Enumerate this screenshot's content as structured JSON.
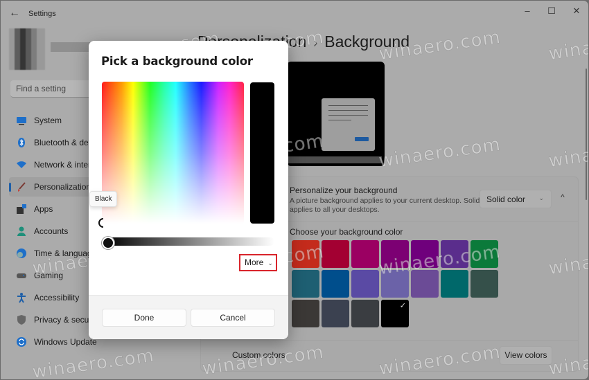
{
  "window": {
    "app_title": "Settings",
    "controls": {
      "minimize": "–",
      "maximize": "☐",
      "close": "✕"
    }
  },
  "sidebar": {
    "search_placeholder": "Find a setting",
    "items": [
      {
        "label": "System",
        "icon": "monitor-icon",
        "color": "#1e6fc9"
      },
      {
        "label": "Bluetooth & devices",
        "icon": "bluetooth-icon",
        "color": "#1e6fc9"
      },
      {
        "label": "Network & internet",
        "icon": "wifi-icon",
        "color": "#1e6fc9"
      },
      {
        "label": "Personalization",
        "icon": "brush-icon",
        "color": "#c4433a",
        "active": true
      },
      {
        "label": "Apps",
        "icon": "apps-icon",
        "color": "#333333"
      },
      {
        "label": "Accounts",
        "icon": "person-icon",
        "color": "#1e8f7a"
      },
      {
        "label": "Time & language",
        "icon": "clock-globe-icon",
        "color": "#1e6fc9"
      },
      {
        "label": "Gaming",
        "icon": "gamepad-icon",
        "color": "#555555"
      },
      {
        "label": "Accessibility",
        "icon": "accessibility-icon",
        "color": "#1e5fa8"
      },
      {
        "label": "Privacy & security",
        "icon": "shield-icon",
        "color": "#666666"
      },
      {
        "label": "Windows Update",
        "icon": "update-icon",
        "color": "#1e6fc9"
      }
    ]
  },
  "main": {
    "breadcrumb_parent": "Personalization",
    "breadcrumb_separator": "›",
    "breadcrumb_current": "Background",
    "personalize_card": {
      "title": "Personalize your background",
      "desc_line1": "A picture background applies to your current desktop. Solid color or slideshow",
      "desc_line2": "applies to all your desktops.",
      "dropdown_value": "Solid color",
      "collapse_icon": "^"
    },
    "color_card": {
      "title": "Choose your background color",
      "swatches": [
        [
          "#c42b1c",
          "#a30032",
          "#9b0062",
          "#7c0073",
          "#6f007c",
          "#5a2d8c",
          "#0b7a3a"
        ],
        [
          "#1e5f72",
          "#004e8c",
          "#5a4aa4",
          "#6b62a8",
          "#6b4b96",
          "#00686a",
          "#35504a"
        ],
        [
          "#3b3836",
          "#3b4150",
          "#3a3d41",
          "#000000"
        ]
      ],
      "selected": "#000000"
    },
    "custom_card": {
      "label": "Custom colors",
      "button": "View colors"
    }
  },
  "dialog": {
    "title": "Pick a background color",
    "tooltip": "Black",
    "selected_color": "#000000",
    "brightness_value": 0,
    "more_label": "More",
    "done_label": "Done",
    "cancel_label": "Cancel"
  },
  "watermark": "winaero.com"
}
